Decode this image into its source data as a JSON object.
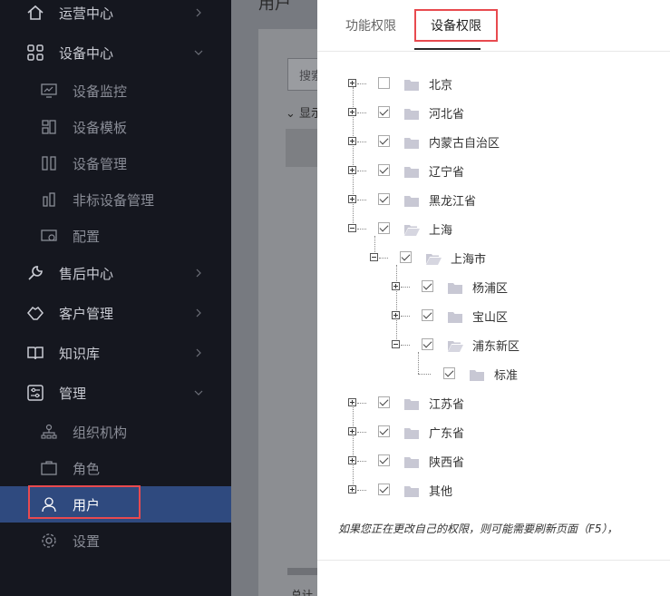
{
  "sidebar": {
    "items": [
      {
        "label": "运营中心",
        "icon": "home-icon"
      },
      {
        "label": "设备中心",
        "icon": "grid-icon"
      },
      {
        "label": "售后中心",
        "icon": "wrench-icon"
      },
      {
        "label": "客户管理",
        "icon": "handshake-icon"
      },
      {
        "label": "知识库",
        "icon": "book-icon"
      },
      {
        "label": "管理",
        "icon": "settings-panel-icon"
      }
    ],
    "device_sub": [
      {
        "label": "设备监控",
        "icon": "monitor-icon"
      },
      {
        "label": "设备模板",
        "icon": "template-icon"
      },
      {
        "label": "设备管理",
        "icon": "device-icon"
      },
      {
        "label": "非标设备管理",
        "icon": "nonstandard-device-icon"
      },
      {
        "label": "配置",
        "icon": "config-icon"
      }
    ],
    "manage_sub": [
      {
        "label": "组织机构",
        "icon": "org-icon"
      },
      {
        "label": "角色",
        "icon": "role-icon"
      },
      {
        "label": "用户",
        "icon": "user-icon",
        "active": true
      },
      {
        "label": "设置",
        "icon": "gear-icon"
      }
    ]
  },
  "main": {
    "title_partial": "用户",
    "search_partial": "搜索",
    "show_partial": "显示",
    "total_partial": "总计"
  },
  "drawer": {
    "tabs": [
      "功能权限",
      "设备权限"
    ],
    "active_tab": "设备权限",
    "tree": [
      {
        "label": "北京",
        "checked": false,
        "expanded": false
      },
      {
        "label": "河北省",
        "checked": true,
        "expanded": false
      },
      {
        "label": "内蒙古自治区",
        "checked": true,
        "expanded": false
      },
      {
        "label": "辽宁省",
        "checked": true,
        "expanded": false
      },
      {
        "label": "黑龙江省",
        "checked": true,
        "expanded": false
      },
      {
        "label": "上海",
        "checked": true,
        "expanded": true
      },
      {
        "label": "上海市",
        "checked": true,
        "expanded": true
      },
      {
        "label": "杨浦区",
        "checked": true,
        "expanded": false
      },
      {
        "label": "宝山区",
        "checked": true,
        "expanded": false
      },
      {
        "label": "浦东新区",
        "checked": true,
        "expanded": true
      },
      {
        "label": "标准",
        "checked": true,
        "expanded": false
      },
      {
        "label": "江苏省",
        "checked": true,
        "expanded": false
      },
      {
        "label": "广东省",
        "checked": true,
        "expanded": false
      },
      {
        "label": "陕西省",
        "checked": true,
        "expanded": false
      },
      {
        "label": "其他",
        "checked": true,
        "expanded": false
      }
    ],
    "note": "如果您正在更改自己的权限，则可能需要刷新页面（F5），"
  },
  "colors": {
    "sidebar_bg": "#15171f",
    "active_bg": "#2f4a7f",
    "highlight": "#e84a4f",
    "folder": "#c8c8d4"
  }
}
